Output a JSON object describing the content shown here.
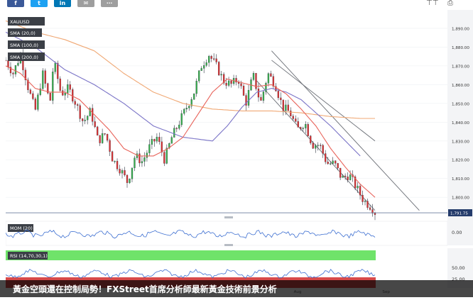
{
  "share_bar": {
    "buttons": [
      {
        "name": "facebook",
        "glyph": "f",
        "color": "#3b5998"
      },
      {
        "name": "twitter",
        "glyph": "t",
        "color": "#1da1f2"
      },
      {
        "name": "linkedin",
        "glyph": "in",
        "color": "#0077b5"
      },
      {
        "name": "email",
        "glyph": "✉",
        "color": "#9e9e9e"
      },
      {
        "name": "more",
        "glyph": "⋯",
        "color": "#9e9e9e"
      }
    ],
    "right_icons": [
      "font-size-icon",
      "print-icon"
    ]
  },
  "caption": "黃金空頭還在控制局勢！FXStreet首席分析師最新黃金技術前景分析",
  "colors": {
    "price": "#2f3542",
    "up_candle": "#37b24d",
    "down_candle": "#e03131",
    "sma20": "#e8635a",
    "sma100": "#7b74c7",
    "sma200": "#f0a874",
    "channel": "#6b6f76",
    "current_price_line": "#6b7e9e",
    "mom_line": "#3d6fd1",
    "rsi_band_green": "#6fe36a",
    "rsi_band_red": "#d84a4a"
  },
  "chart_data": {
    "type": "line",
    "symbol": "XAUUSD",
    "legend": [
      "XAUUSD",
      "SMA (20,0)",
      "SMA (100,0)",
      "SMA (200,0)"
    ],
    "y_ticks": [
      "1,890.00",
      "1,880.00",
      "1,870.00",
      "1,860.00",
      "1,850.00",
      "1,840.00",
      "1,830.00",
      "1,820.00",
      "1,810.00",
      "1,800.00"
    ],
    "y_range": [
      1791,
      1893
    ],
    "last_price": 1791.75,
    "last_price_label": "1,791.75",
    "x_labels": [
      "Aug",
      "Sep"
    ],
    "x_label_positions": [
      78,
      102
    ],
    "price_anchors": [
      [
        0,
        1873
      ],
      [
        2,
        1866
      ],
      [
        4,
        1876
      ],
      [
        6,
        1859
      ],
      [
        8,
        1846
      ],
      [
        10,
        1866
      ],
      [
        12,
        1850
      ],
      [
        13,
        1873
      ],
      [
        15,
        1855
      ],
      [
        17,
        1858
      ],
      [
        19,
        1850
      ],
      [
        21,
        1840
      ],
      [
        23,
        1846
      ],
      [
        25,
        1830
      ],
      [
        27,
        1834
      ],
      [
        29,
        1820
      ],
      [
        31,
        1815
      ],
      [
        33,
        1808
      ],
      [
        35,
        1822
      ],
      [
        37,
        1819
      ],
      [
        39,
        1827
      ],
      [
        41,
        1832
      ],
      [
        43,
        1820
      ],
      [
        45,
        1832
      ],
      [
        47,
        1840
      ],
      [
        49,
        1848
      ],
      [
        51,
        1856
      ],
      [
        53,
        1870
      ],
      [
        55,
        1876
      ],
      [
        57,
        1870
      ],
      [
        59,
        1862
      ],
      [
        61,
        1860
      ],
      [
        63,
        1863
      ],
      [
        65,
        1850
      ],
      [
        67,
        1865
      ],
      [
        69,
        1850
      ],
      [
        71,
        1866
      ],
      [
        73,
        1860
      ],
      [
        75,
        1848
      ],
      [
        77,
        1845
      ],
      [
        79,
        1836
      ],
      [
        81,
        1840
      ],
      [
        83,
        1828
      ],
      [
        85,
        1828
      ],
      [
        87,
        1818
      ],
      [
        89,
        1818
      ],
      [
        91,
        1810
      ],
      [
        93,
        1812
      ],
      [
        95,
        1805
      ],
      [
        97,
        1798
      ],
      [
        99,
        1795
      ],
      [
        100,
        1792
      ]
    ],
    "sma20_anchors": [
      [
        0,
        1870
      ],
      [
        4,
        1866
      ],
      [
        8,
        1858
      ],
      [
        12,
        1856
      ],
      [
        16,
        1856
      ],
      [
        20,
        1852
      ],
      [
        24,
        1844
      ],
      [
        28,
        1836
      ],
      [
        32,
        1826
      ],
      [
        36,
        1822
      ],
      [
        40,
        1822
      ],
      [
        44,
        1826
      ],
      [
        48,
        1832
      ],
      [
        52,
        1844
      ],
      [
        56,
        1856
      ],
      [
        60,
        1863
      ],
      [
        64,
        1861
      ],
      [
        68,
        1859
      ],
      [
        72,
        1860
      ],
      [
        76,
        1855
      ],
      [
        80,
        1847
      ],
      [
        84,
        1838
      ],
      [
        88,
        1826
      ],
      [
        92,
        1816
      ],
      [
        96,
        1807
      ],
      [
        100,
        1800
      ]
    ],
    "sma100_anchors": [
      [
        0,
        1888
      ],
      [
        8,
        1880
      ],
      [
        16,
        1868
      ],
      [
        24,
        1860
      ],
      [
        32,
        1850
      ],
      [
        40,
        1838
      ],
      [
        48,
        1832
      ],
      [
        56,
        1830
      ],
      [
        60,
        1838
      ],
      [
        64,
        1848
      ],
      [
        68,
        1856
      ],
      [
        72,
        1858
      ],
      [
        76,
        1856
      ],
      [
        80,
        1852
      ],
      [
        84,
        1845
      ],
      [
        88,
        1838
      ],
      [
        92,
        1830
      ],
      [
        96,
        1822
      ]
    ],
    "sma200_anchors": [
      [
        0,
        1894
      ],
      [
        8,
        1888
      ],
      [
        16,
        1884
      ],
      [
        24,
        1878
      ],
      [
        32,
        1866
      ],
      [
        40,
        1856
      ],
      [
        48,
        1850
      ],
      [
        56,
        1847
      ],
      [
        64,
        1846
      ],
      [
        72,
        1846
      ],
      [
        80,
        1845
      ],
      [
        88,
        1843
      ],
      [
        96,
        1842
      ],
      [
        100,
        1842
      ]
    ],
    "channel_lines": [
      {
        "from": [
          72,
          1878
        ],
        "to": [
          112,
          1793
        ]
      },
      {
        "from": [
          68,
          1862
        ],
        "to": [
          100,
          1793
        ]
      },
      {
        "from": [
          72,
          1873
        ],
        "to": [
          100,
          1830
        ]
      }
    ],
    "mom_panel": {
      "label": "MOM (20)",
      "y_tick": "0.00"
    },
    "rsi_panel": {
      "label": "RSI (14,70,30,1)",
      "y_ticks": [
        "50.00",
        "25.00"
      ]
    }
  }
}
